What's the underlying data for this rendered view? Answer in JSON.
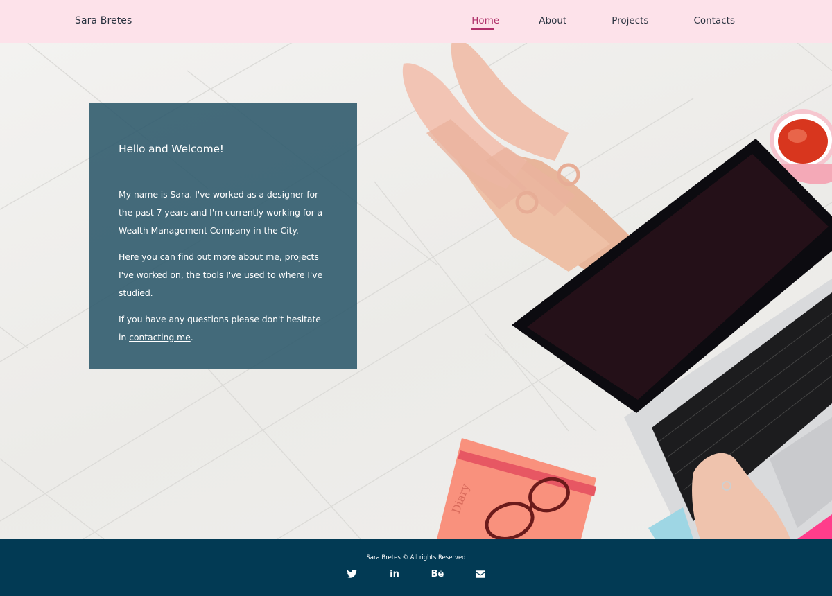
{
  "header": {
    "brand": "Sara Bretes",
    "nav": [
      {
        "label": "Home",
        "active": true
      },
      {
        "label": "About"
      },
      {
        "label": "Projects"
      },
      {
        "label": "Contacts"
      }
    ],
    "background_color": "#fde2ea",
    "active_color": "#b0306a"
  },
  "hero": {
    "card": {
      "title": "Hello and Welcome!",
      "paragraph_1": "My name is Sara. I've worked as a designer for the past 7 years and I'm currently working for a Wealth Management Company in the City.",
      "paragraph_2": "Here you can find out more about me, projects I've worked on, the tools I've used to where I've studied.",
      "paragraph_3_text": "If you have any questions please don't hesitate in",
      "paragraph_3_link": "contacting me",
      "paragraph_3_end": ".",
      "background_color": "#2b586a"
    },
    "notebook_label": "Diary"
  },
  "footer": {
    "copyright": "Sara Bretes © All rights Reserved",
    "socials": [
      {
        "icon": "twitter-icon"
      },
      {
        "icon": "linkedin-icon",
        "text": "in"
      },
      {
        "icon": "behance-icon",
        "text": "Bē"
      },
      {
        "icon": "envelope-icon"
      }
    ],
    "background_color": "#023a54"
  }
}
